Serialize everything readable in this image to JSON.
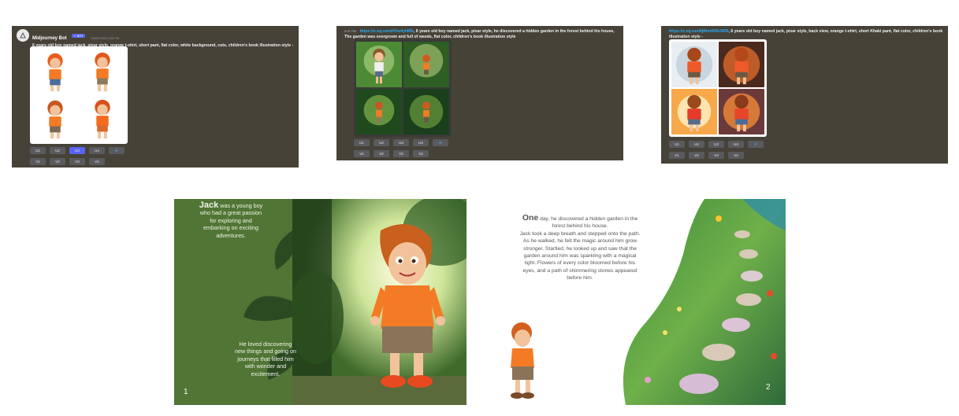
{
  "panel1": {
    "bot_name": "Midjourney Bot",
    "badge": "✓ BOT",
    "timestamp": "09/04/2023 5:55 PM",
    "prompt": "6 years old boy named jack, pixar style, orange t-shirt, short pant, flat color, white background, cute, children's book illustration style -",
    "upscale_buttons": [
      "U1",
      "U2",
      "U3",
      "U4"
    ],
    "variation_buttons": [
      "V1",
      "V2",
      "V3",
      "V4"
    ],
    "active_button": "U3"
  },
  "panel2": {
    "timestamp": "5:57 PM",
    "link": "https://s.mj.run/dVhe4yl4Rk",
    "prompt": ", 6 years old boy named jack, pixar style, he discovered a hidden garden in the forest behind his house, The garden was overgrown and full of weeds, flat color, children's book illustration style",
    "upscale_buttons": [
      "U1",
      "U2",
      "U3",
      "U4"
    ],
    "variation_buttons": [
      "V1",
      "V2",
      "V3",
      "V4"
    ]
  },
  "panel3": {
    "link": "https://s.mj.run/8jBlmW0b3WN",
    "prompt": ", 6 years old boy named jack, pixar style, back view, orange t-shirt, short Khaki pant, flat color, children's book illustration style -",
    "upscale_buttons": [
      "U1",
      "U2",
      "U3",
      "U4"
    ],
    "variation_buttons": [
      "V1",
      "V2",
      "V3",
      "V4"
    ]
  },
  "page1": {
    "intro_bold": "Jack",
    "intro_lines": [
      "was a young boy",
      "who had a great passion",
      "for exploring and",
      "embarking on exciting",
      "adventures."
    ],
    "para2_lines": [
      "He loved discovering",
      "new things and going on",
      "journeys that filled him",
      "with wonder and",
      "excitement."
    ],
    "page_number": "1"
  },
  "page2": {
    "first_word": "One",
    "first_line_rest": "day, he discovered a hidden garden in the",
    "lines": [
      "forest behind his house.",
      "Jack took a deep breath and stepped onto the path.",
      "As he walked, he felt the magic around him grow",
      "stronger. Startled, he looked up and saw that the",
      "garden around him was sparkling with a magical",
      "light. Flowers of every color bloomed before his",
      "eyes, and a path of shimmering stones appeared",
      "before him."
    ],
    "page_number": "2"
  },
  "colors": {
    "discord_bg": "#474238",
    "blurple": "#5865f2",
    "link": "#2ba8ef",
    "book_green": "#517535"
  }
}
